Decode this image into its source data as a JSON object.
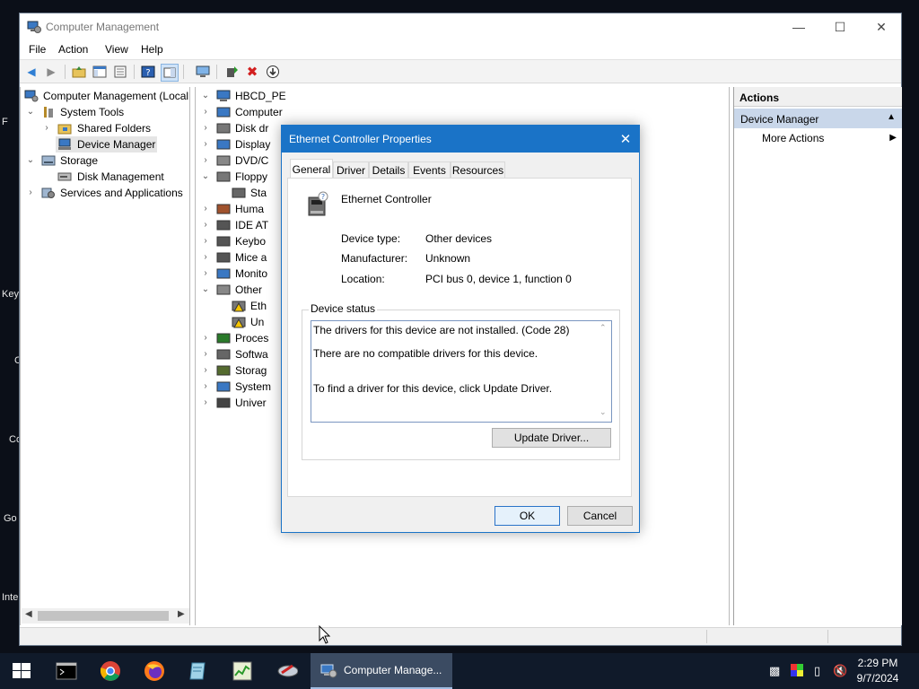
{
  "desktop": {
    "fragments": [
      "F",
      "Key",
      "C",
      "Co",
      "Go",
      "Inte"
    ]
  },
  "window": {
    "title": "Computer Management",
    "menu": [
      "File",
      "Action",
      "View",
      "Help"
    ]
  },
  "tree_left": {
    "root": "Computer Management (Local",
    "system_tools": "System Tools",
    "shared_folders": "Shared Folders",
    "device_manager": "Device Manager",
    "storage": "Storage",
    "disk_management": "Disk Management",
    "services": "Services and Applications"
  },
  "device_tree": {
    "root": "HBCD_PE",
    "items": [
      "Computer",
      "Disk dr",
      "Display",
      "DVD/C",
      "Floppy",
      "Sta",
      "Huma",
      "IDE AT",
      "Keybo",
      "Mice a",
      "Monito",
      "Other",
      "Eth",
      "Un",
      "Proces",
      "Softwa",
      "Storag",
      "System",
      "Univer"
    ]
  },
  "actions": {
    "header": "Actions",
    "section": "Device Manager",
    "more": "More Actions"
  },
  "dialog": {
    "title": "Ethernet Controller Properties",
    "tabs": [
      "General",
      "Driver",
      "Details",
      "Events",
      "Resources"
    ],
    "device_name": "Ethernet Controller",
    "device_type_label": "Device type:",
    "device_type": "Other devices",
    "manufacturer_label": "Manufacturer:",
    "manufacturer": "Unknown",
    "location_label": "Location:",
    "location": "PCI bus 0, device 1, function 0",
    "status_group": "Device status",
    "status_line1": "The drivers for this device are not installed. (Code 28)",
    "status_line2": "There are no compatible drivers for this device.",
    "status_line3": "To find a driver for this device, click Update Driver.",
    "update_button": "Update Driver...",
    "ok": "OK",
    "cancel": "Cancel"
  },
  "taskbar": {
    "active_app": "Computer Manage...",
    "time": "2:29 PM",
    "date": "9/7/2024"
  },
  "colors": {
    "accent": "#1a73c7",
    "taskbar": "#101a2a",
    "selection": "#c9d7ea"
  }
}
